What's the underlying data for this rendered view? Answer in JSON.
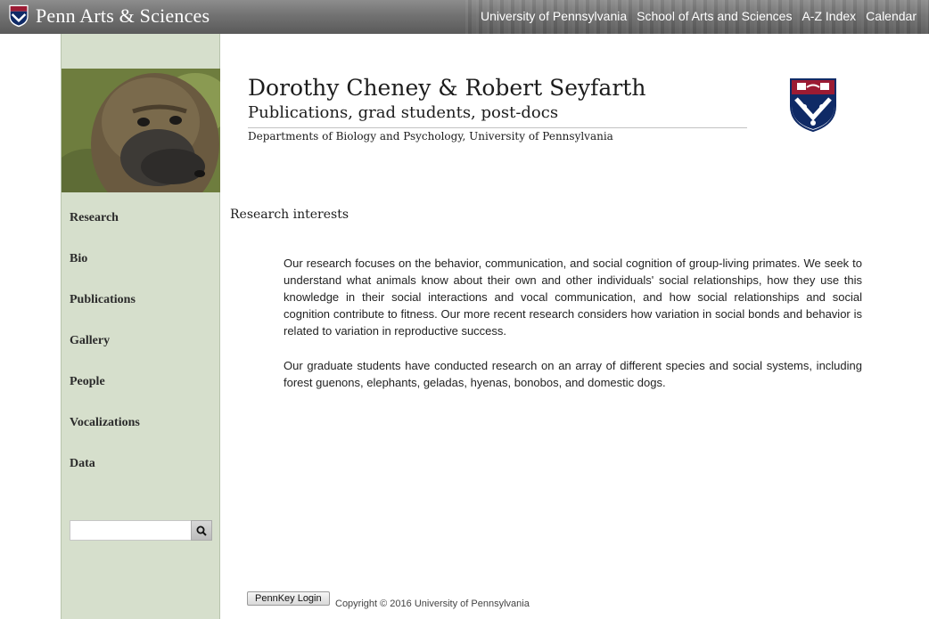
{
  "topbar": {
    "brand": "Penn Arts & Sciences",
    "links": [
      "University of Pennsylvania",
      "School of Arts and Sciences",
      "A-Z Index",
      "Calendar"
    ]
  },
  "header": {
    "title": "Dorothy Cheney & Robert Seyfarth",
    "subtitle": "Publications, grad students, post-docs",
    "department": "Departments of Biology and Psychology, University of Pennsylvania"
  },
  "sidebar": {
    "nav": [
      "Research",
      "Bio",
      "Publications",
      "Gallery",
      "People",
      "Vocalizations",
      "Data"
    ],
    "search": {
      "value": "",
      "placeholder": ""
    }
  },
  "main": {
    "section_title": "Research interests",
    "paragraphs": [
      "Our research focuses on the behavior, communication, and social cognition of group-living primates. We seek to understand what animals know about their own and other individuals' social relationships, how they use this knowledge in their social interactions and vocal communication, and how social relationships and social cognition contribute to fitness. Our more recent research considers how variation in social bonds and behavior is related to variation in reproductive success.",
      "Our graduate students have conducted research on an array of different species and social systems, including forest guenons, elephants, geladas, hyenas, bonobos, and domestic dogs."
    ]
  },
  "footer": {
    "login_label": "PennKey Login",
    "copyright": "Copyright © 2016 University of Pennsylvania"
  },
  "colors": {
    "sidebar_bg": "#d6dfcc",
    "shield_red": "#9b1b33",
    "shield_blue": "#0f2a66"
  },
  "icons": [
    "penn-shield-icon",
    "search-icon"
  ]
}
